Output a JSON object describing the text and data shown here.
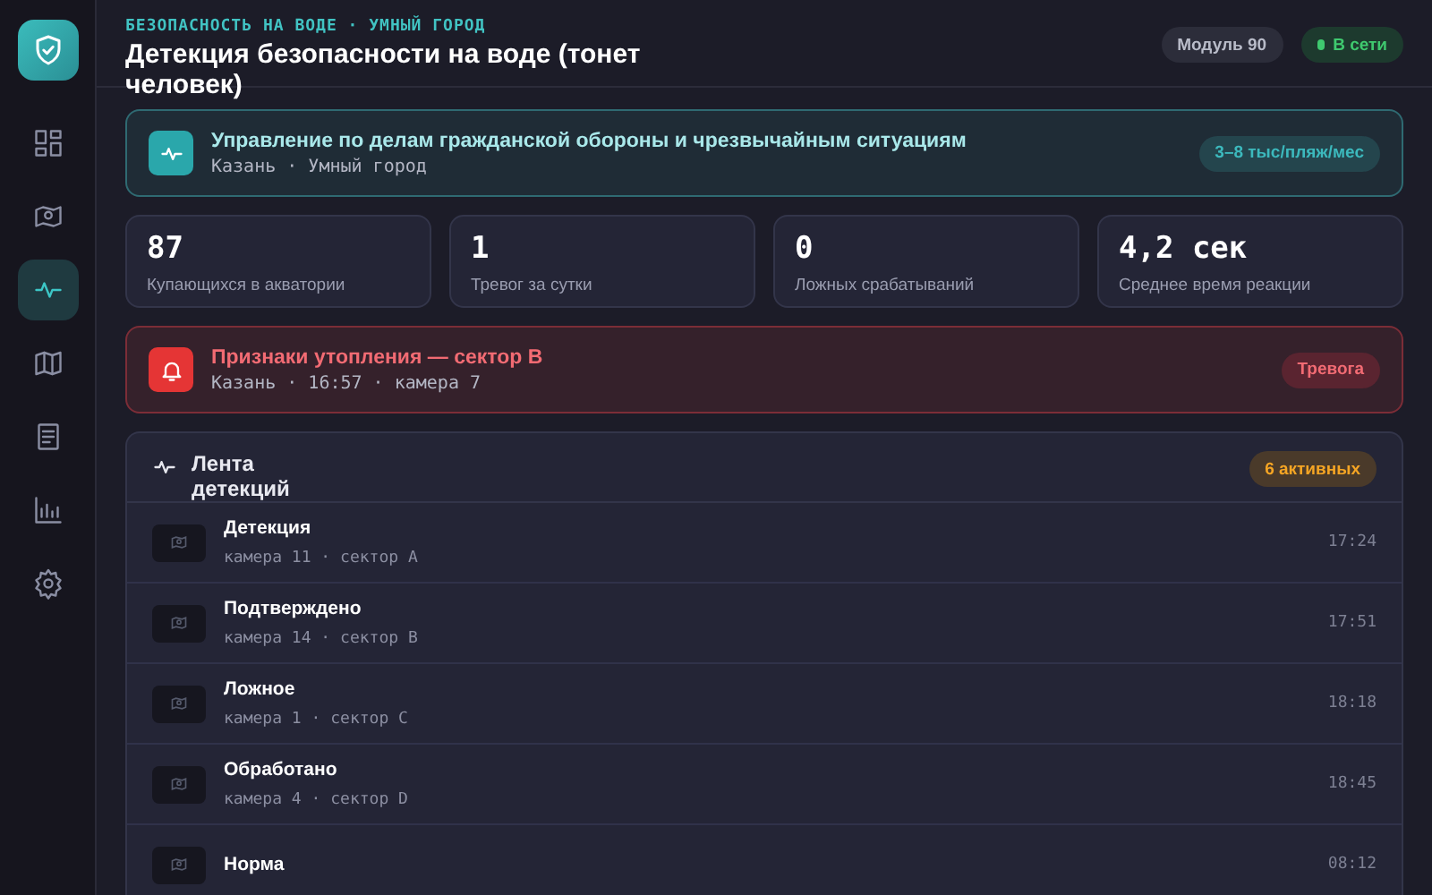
{
  "sidebar": {
    "items": [
      {
        "kind": "grid",
        "selected": false
      },
      {
        "kind": "pin",
        "selected": false
      },
      {
        "kind": "pulse",
        "selected": true
      },
      {
        "kind": "map",
        "selected": false
      },
      {
        "kind": "document",
        "selected": false
      },
      {
        "kind": "chart",
        "selected": false
      },
      {
        "kind": "settings",
        "selected": false
      }
    ]
  },
  "header": {
    "kicker": "БЕЗОПАСНОСТЬ НА ВОДЕ · УМНЫЙ ГОРОД",
    "title": "Детекция безопасности на воде (тонет человек)",
    "module": "Модуль 90",
    "status": {
      "label": "В сети",
      "online": true
    }
  },
  "org": {
    "title": "Управление по делам гражданской обороны и чрезвычайным ситуациям",
    "subtitle": "Казань · Умный город",
    "price": "3–8 тыс/пляж/мес"
  },
  "stats": [
    {
      "value": "87",
      "label": "Купающихся в акватории"
    },
    {
      "value": "1",
      "label": "Тревог за сутки"
    },
    {
      "value": "0",
      "label": "Ложных срабатываний"
    },
    {
      "value": "4,2 сек",
      "label": "Среднее время реакции"
    }
  ],
  "alert": {
    "title": "Признаки утопления — сектор B",
    "subtitle": "Казань · 16:57 · камера 7",
    "badge": "Тревога"
  },
  "feed": {
    "title": "Лента детекций",
    "badge": "6 активных",
    "rows": [
      {
        "title": "Детекция",
        "subtitle": "камера 11 · сектор A",
        "time": "17:24"
      },
      {
        "title": "Подтверждено",
        "subtitle": "камера 14 · сектор B",
        "time": "17:51"
      },
      {
        "title": "Ложное",
        "subtitle": "камера 1 · сектор C",
        "time": "18:18"
      },
      {
        "title": "Обработано",
        "subtitle": "камера 4 · сектор D",
        "time": "18:45"
      },
      {
        "title": "Норма",
        "time": "08:12"
      }
    ]
  }
}
